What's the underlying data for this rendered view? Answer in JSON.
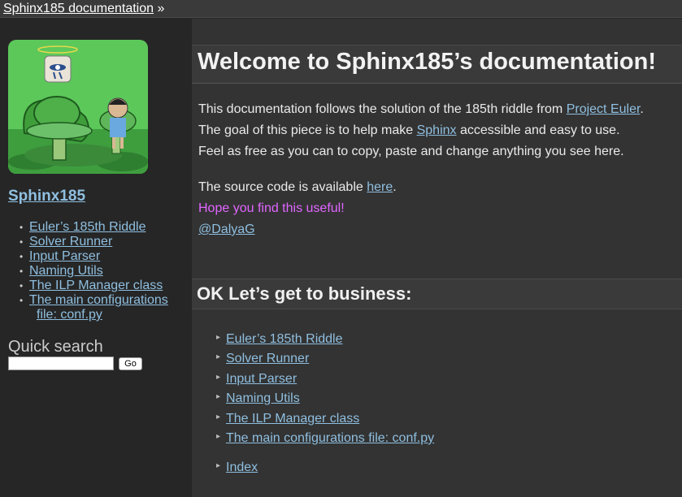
{
  "breadcrumb": {
    "link": "Sphinx185 documentation",
    "sep": "»"
  },
  "sidebar": {
    "project_title": "Sphinx185",
    "toc": [
      "Euler’s 185th Riddle",
      "Solver Runner",
      "Input Parser",
      "Naming Utils",
      "The ILP Manager class"
    ],
    "toc_last_line1": "The main configurations",
    "toc_last_line2": "file: conf.py",
    "quick_search": "Quick search",
    "search_value": "",
    "go_label": "Go"
  },
  "main": {
    "title": "Welcome to Sphinx185’s documentation!",
    "p1_pre": "This documentation follows the solution of the 185th riddle from ",
    "p1_link": "Project Euler",
    "p1_post": ".",
    "p2_pre": "The goal of this piece is to help make ",
    "p2_link": "Sphinx",
    "p2_post": " accessible and easy to use.",
    "p3": "Feel as free as you can to copy, paste and change anything you see here.",
    "p4_pre": "The source code is available ",
    "p4_link": "here",
    "p4_post": ".",
    "hope": "Hope you find this useful!",
    "author": "@DalyaG",
    "section_title": "OK Let’s get to business:",
    "toc": [
      "Euler’s 185th Riddle",
      "Solver Runner",
      "Input Parser",
      "Naming Utils",
      "The ILP Manager class",
      "The main configurations file: conf.py"
    ],
    "index": "Index"
  },
  "colors": {
    "link": "#8fbfe0",
    "accent_pink": "#e066ff",
    "background": "#262626"
  }
}
